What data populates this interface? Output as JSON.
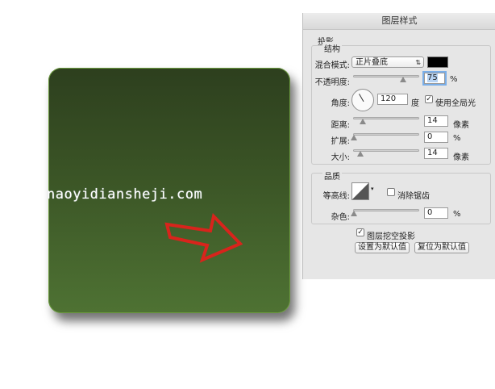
{
  "watermark": "naoyidiansheji.com",
  "dialog": {
    "title": "图层样式",
    "section": "投影",
    "structure": {
      "heading": "结构",
      "blend_mode_label": "混合模式:",
      "blend_mode_value": "正片叠底",
      "shadow_color": "#000000",
      "opacity_label": "不透明度:",
      "opacity_value": "75",
      "opacity_unit": "%",
      "opacity_level": 0.75,
      "angle_label": "角度:",
      "angle_value": "120",
      "angle_unit": "度",
      "global_light_label": "使用全局光",
      "global_light_checked": true,
      "distance_label": "距离:",
      "distance_value": "14",
      "distance_unit": "像素",
      "spread_label": "扩展:",
      "spread_value": "0",
      "spread_unit": "%",
      "size_label": "大小:",
      "size_value": "14",
      "size_unit": "像素"
    },
    "quality": {
      "heading": "品质",
      "contour_label": "等高线:",
      "anti_alias_label": "消除锯齿",
      "anti_alias_checked": false,
      "noise_label": "杂色:",
      "noise_value": "0",
      "noise_unit": "%"
    },
    "knockout_label": "图层挖空投影",
    "knockout_checked": true,
    "set_default_label": "设置为默认值",
    "reset_default_label": "复位为默认值"
  }
}
